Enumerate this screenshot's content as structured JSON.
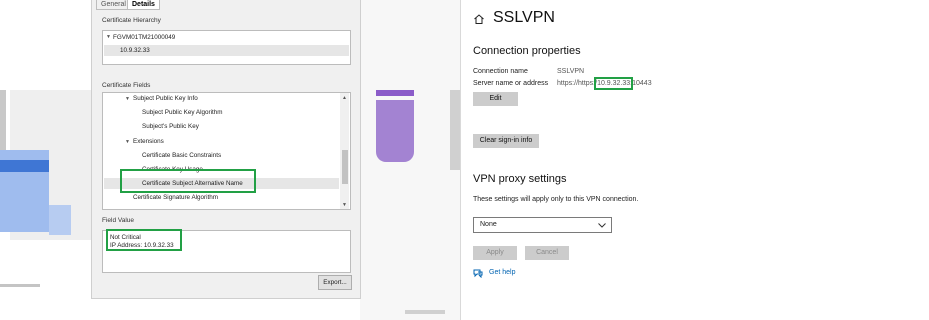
{
  "certificate_dialog": {
    "tabs": [
      "General",
      "Details"
    ],
    "hierarchy_label": "Certificate Hierarchy",
    "hierarchy": [
      "FGVM01TM21000049",
      "10.9.32.33"
    ],
    "fields_label": "Certificate Fields",
    "fields": [
      "Subject Public Key Info",
      "Subject Public Key Algorithm",
      "Subject's Public Key",
      "Extensions",
      "Certificate Basic Constraints",
      "Certificate Key Usage",
      "Certificate Subject Alternative Name",
      "Certificate Signature Algorithm"
    ],
    "field_value_label": "Field Value",
    "field_value_lines": [
      "Not Critical",
      "IP Address: 10.9.32.33"
    ],
    "export_button": "Export..."
  },
  "vpn_settings": {
    "title": "SSLVPN",
    "connection_properties_heading": "Connection properties",
    "connection_name_label": "Connection name",
    "connection_name_value": "SSLVPN",
    "server_label": "Server name or address",
    "server_prefix": "https://https:/",
    "server_ip": "10.9.32.33",
    "server_suffix": ":10443",
    "edit_button": "Edit",
    "clear_button": "Clear sign-in info",
    "proxy_heading": "VPN proxy settings",
    "proxy_note": "These settings will apply only to this VPN connection.",
    "proxy_option": "None",
    "apply_button": "Apply",
    "cancel_button": "Cancel",
    "help_link": "Get help"
  },
  "colors": {
    "highlight": "#22a045",
    "link": "#0063b1",
    "accent_purple": "#9a73c9",
    "accent_blue": "#5a86d6"
  }
}
